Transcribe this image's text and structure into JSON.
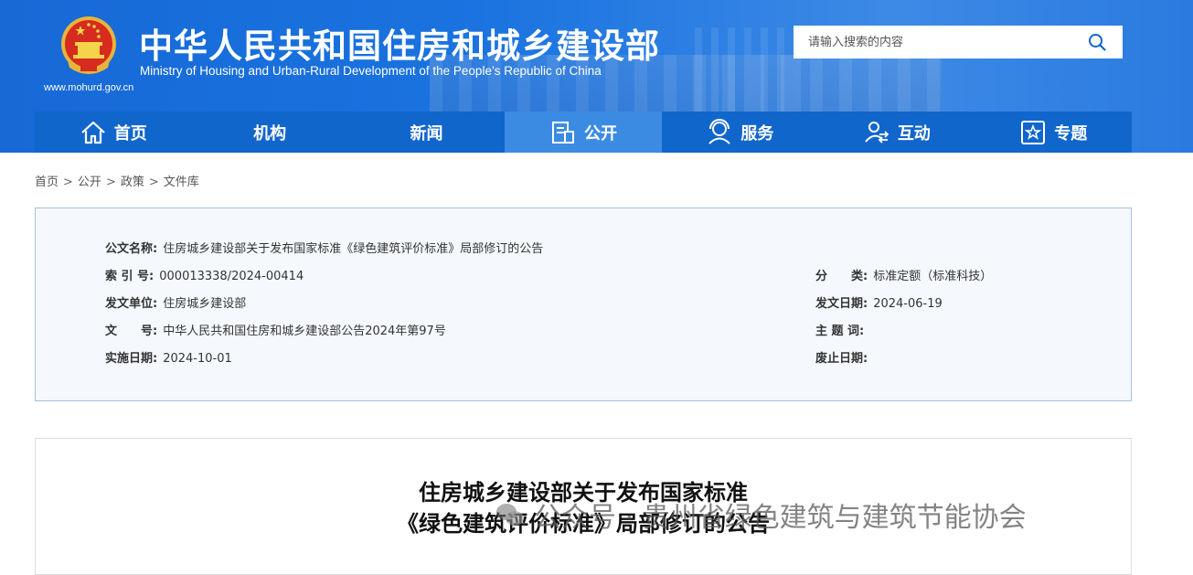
{
  "header": {
    "title_cn": "中华人民共和国住房和城乡建设部",
    "title_en": "Ministry of Housing and Urban-Rural Development of the People’s Republic of China",
    "site_url": "www.mohurd.gov.cn",
    "search_placeholder": "请输入搜索的内容",
    "brand_color": "#1166cc"
  },
  "nav": {
    "items": [
      {
        "label": "首页",
        "icon": "home-icon"
      },
      {
        "label": "机构",
        "icon": ""
      },
      {
        "label": "新闻",
        "icon": ""
      },
      {
        "label": "公开",
        "icon": "document-icon",
        "active": true
      },
      {
        "label": "服务",
        "icon": "service-icon"
      },
      {
        "label": "互动",
        "icon": "interact-icon"
      },
      {
        "label": "专题",
        "icon": "star-icon"
      }
    ]
  },
  "breadcrumb": [
    "首页",
    "公开",
    "政策",
    "文件库"
  ],
  "info": {
    "doc_name_label": "公文名称:",
    "doc_name": "住房城乡建设部关于发布国家标准《绿色建筑评价标准》局部修订的公告",
    "index_label": "索 引 号:",
    "index": "000013338/2024-00414",
    "category_label": "分　　类:",
    "category": "标准定额（标准科技）",
    "issuer_label": "发文单位:",
    "issuer": "住房城乡建设部",
    "issue_date_label": "发文日期:",
    "issue_date": "2024-06-19",
    "doc_no_label": "文　　号:",
    "doc_no": "中华人民共和国住房和城乡建设部公告2024年第97号",
    "keywords_label": "主 题 词:",
    "keywords": "",
    "effective_label": "实施日期:",
    "effective": "2024-10-01",
    "abolish_label": "废止日期:",
    "abolish": ""
  },
  "content": {
    "title_line1": "住房城乡建设部关于发布国家标准",
    "title_line2": "《绿色建筑评价标准》局部修订的公告"
  },
  "watermark": {
    "text": "公众号 · 贵州省绿色建筑与建筑节能协会"
  }
}
